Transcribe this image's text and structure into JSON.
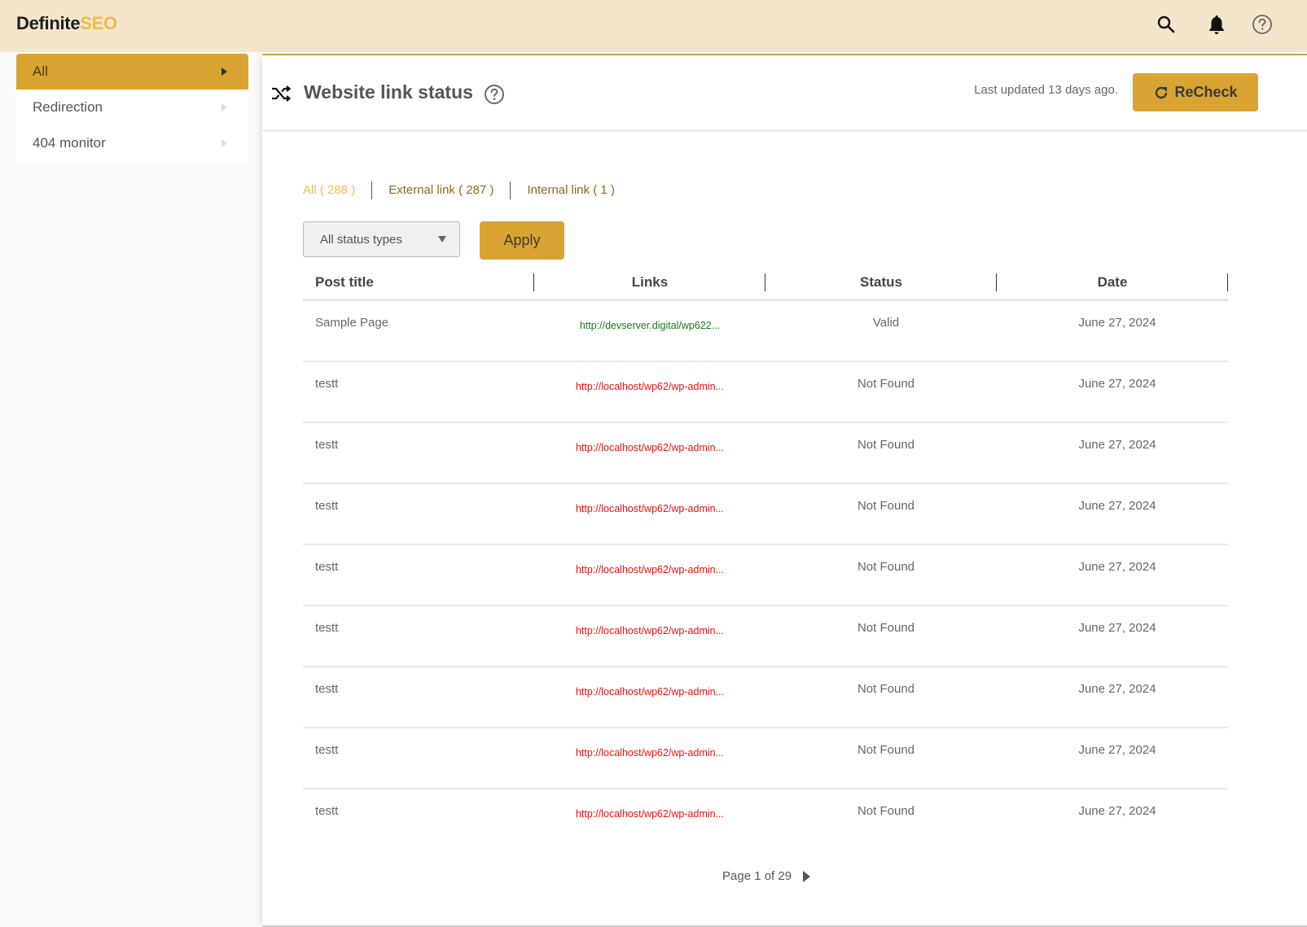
{
  "brand": {
    "part1": "Definite",
    "part2": "SEO"
  },
  "topbar": {
    "icons": [
      "search-icon",
      "bell-icon",
      "help-icon"
    ]
  },
  "sidebar": {
    "items": [
      {
        "label": "All",
        "active": true
      },
      {
        "label": "Redirection",
        "active": false
      },
      {
        "label": "404 monitor",
        "active": false
      }
    ]
  },
  "header": {
    "title": "Website link status",
    "last_updated": "Last updated 13 days ago.",
    "recheck_label": "ReCheck"
  },
  "filters": {
    "tabs": [
      {
        "label": "All ( 288 )",
        "active": true
      },
      {
        "label": "External link ( 287 )",
        "active": false
      },
      {
        "label": "Internal link ( 1 )",
        "active": false
      }
    ],
    "status_select": "All status types",
    "apply_label": "Apply"
  },
  "table": {
    "columns": [
      "Post title",
      "Links",
      "Status",
      "Date"
    ],
    "rows": [
      {
        "title": "Sample Page",
        "link": "http://devserver.digital/wp622...",
        "status": "Valid",
        "date": "June 27, 2024",
        "link_color": "#1a7a1a"
      },
      {
        "title": "testt",
        "link": "http://localhost/wp62/wp-admin...",
        "status": "Not Found",
        "date": "June 27, 2024",
        "link_color": "#ee1111"
      },
      {
        "title": "testt",
        "link": "http://localhost/wp62/wp-admin...",
        "status": "Not Found",
        "date": "June 27, 2024",
        "link_color": "#ee1111"
      },
      {
        "title": "testt",
        "link": "http://localhost/wp62/wp-admin...",
        "status": "Not Found",
        "date": "June 27, 2024",
        "link_color": "#ee1111"
      },
      {
        "title": "testt",
        "link": "http://localhost/wp62/wp-admin...",
        "status": "Not Found",
        "date": "June 27, 2024",
        "link_color": "#ee1111"
      },
      {
        "title": "testt",
        "link": "http://localhost/wp62/wp-admin...",
        "status": "Not Found",
        "date": "June 27, 2024",
        "link_color": "#ee1111"
      },
      {
        "title": "testt",
        "link": "http://localhost/wp62/wp-admin...",
        "status": "Not Found",
        "date": "June 27, 2024",
        "link_color": "#ee1111"
      },
      {
        "title": "testt",
        "link": "http://localhost/wp62/wp-admin...",
        "status": "Not Found",
        "date": "June 27, 2024",
        "link_color": "#ee1111"
      },
      {
        "title": "testt",
        "link": "http://localhost/wp62/wp-admin...",
        "status": "Not Found",
        "date": "June 27, 2024",
        "link_color": "#ee1111"
      }
    ]
  },
  "pagination": {
    "label": "Page 1 of 29",
    "current": 1,
    "total": 29
  },
  "colors": {
    "accent": "#d9a431",
    "topbar_bg": "#f4e6cc",
    "brand_seo": "#f0bb45",
    "valid_link": "#1a7a1a",
    "broken_link": "#ee1111"
  }
}
